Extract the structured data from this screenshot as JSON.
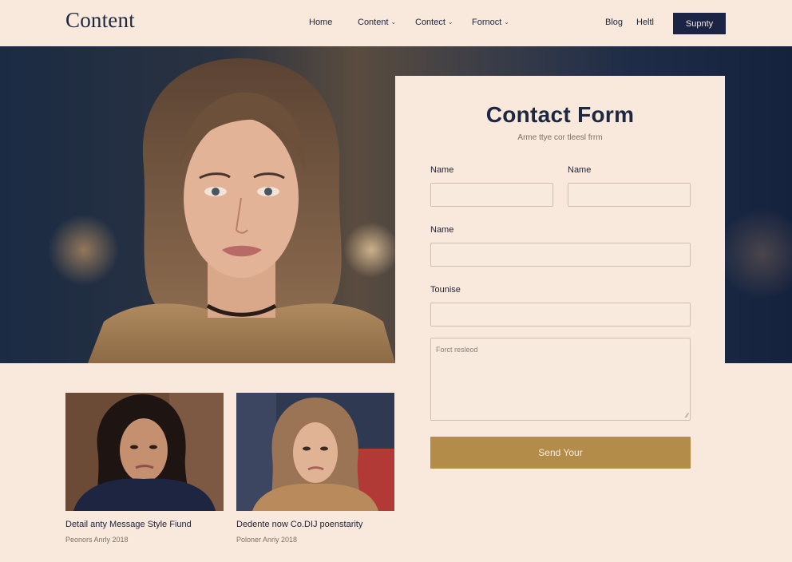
{
  "header": {
    "logo": "Content",
    "nav": [
      {
        "label": "Home",
        "dropdown": false
      },
      {
        "label": "Content",
        "dropdown": true
      },
      {
        "label": "Contect",
        "dropdown": true
      },
      {
        "label": "Fornoct",
        "dropdown": true
      }
    ],
    "links": [
      "Blog",
      "Heltl"
    ],
    "cta_label": "Supnty"
  },
  "form": {
    "title": "Contact Form",
    "subtitle": "Arme ttye cor tleesl frrm",
    "label_name_1": "Name",
    "label_name_2": "Name",
    "label_name_3": "Name",
    "label_tounise": "Tounise",
    "textarea_placeholder": "Forct resleod",
    "submit_label": "Send Your"
  },
  "cards": [
    {
      "title": "Detail anty Message Style Fiund",
      "meta": "Peonors Anrly 2018"
    },
    {
      "title": "Dedente now Co.DIJ poenstarity",
      "meta": "Poloner Anriy 2018"
    }
  ],
  "colors": {
    "background": "#f8e9dc",
    "navy": "#1b2444",
    "accent_gold": "#b48c4a"
  }
}
